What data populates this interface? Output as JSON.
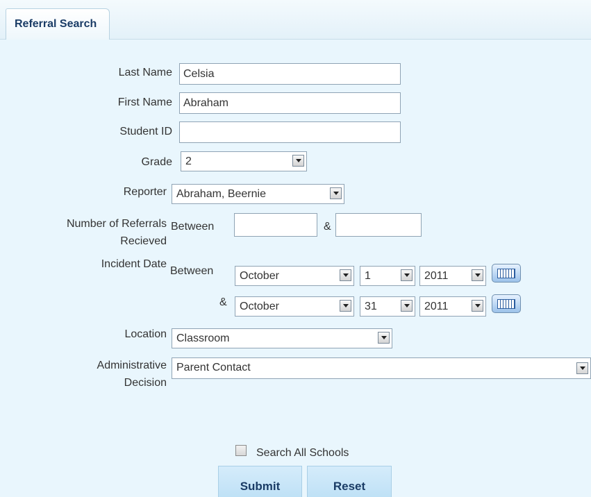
{
  "tab": {
    "label": "Referral Search"
  },
  "form": {
    "last_name": {
      "label": "Last Name",
      "value": "Celsia"
    },
    "first_name": {
      "label": "First Name",
      "value": "Abraham"
    },
    "student_id": {
      "label": "Student ID",
      "value": ""
    },
    "grade": {
      "label": "Grade",
      "value": "2"
    },
    "reporter": {
      "label": "Reporter",
      "value": "Abraham, Beernie"
    },
    "referrals": {
      "label_line1": "Number of Referrals",
      "label_line2": "Recieved",
      "between": "Between",
      "and": "&",
      "min": "",
      "max": ""
    },
    "incident_date": {
      "label": "Incident Date",
      "between": "Between",
      "and": "&",
      "from": {
        "month": "October",
        "day": "1",
        "year": "2011"
      },
      "to": {
        "month": "October",
        "day": "31",
        "year": "2011"
      }
    },
    "location": {
      "label": "Location",
      "value": "Classroom"
    },
    "admin_decision": {
      "label_line1": "Administrative",
      "label_line2": "Decision",
      "value": "Parent Contact"
    },
    "search_all": {
      "label": "Search All Schools",
      "checked": false
    }
  },
  "buttons": {
    "submit": "Submit",
    "reset": "Reset"
  }
}
